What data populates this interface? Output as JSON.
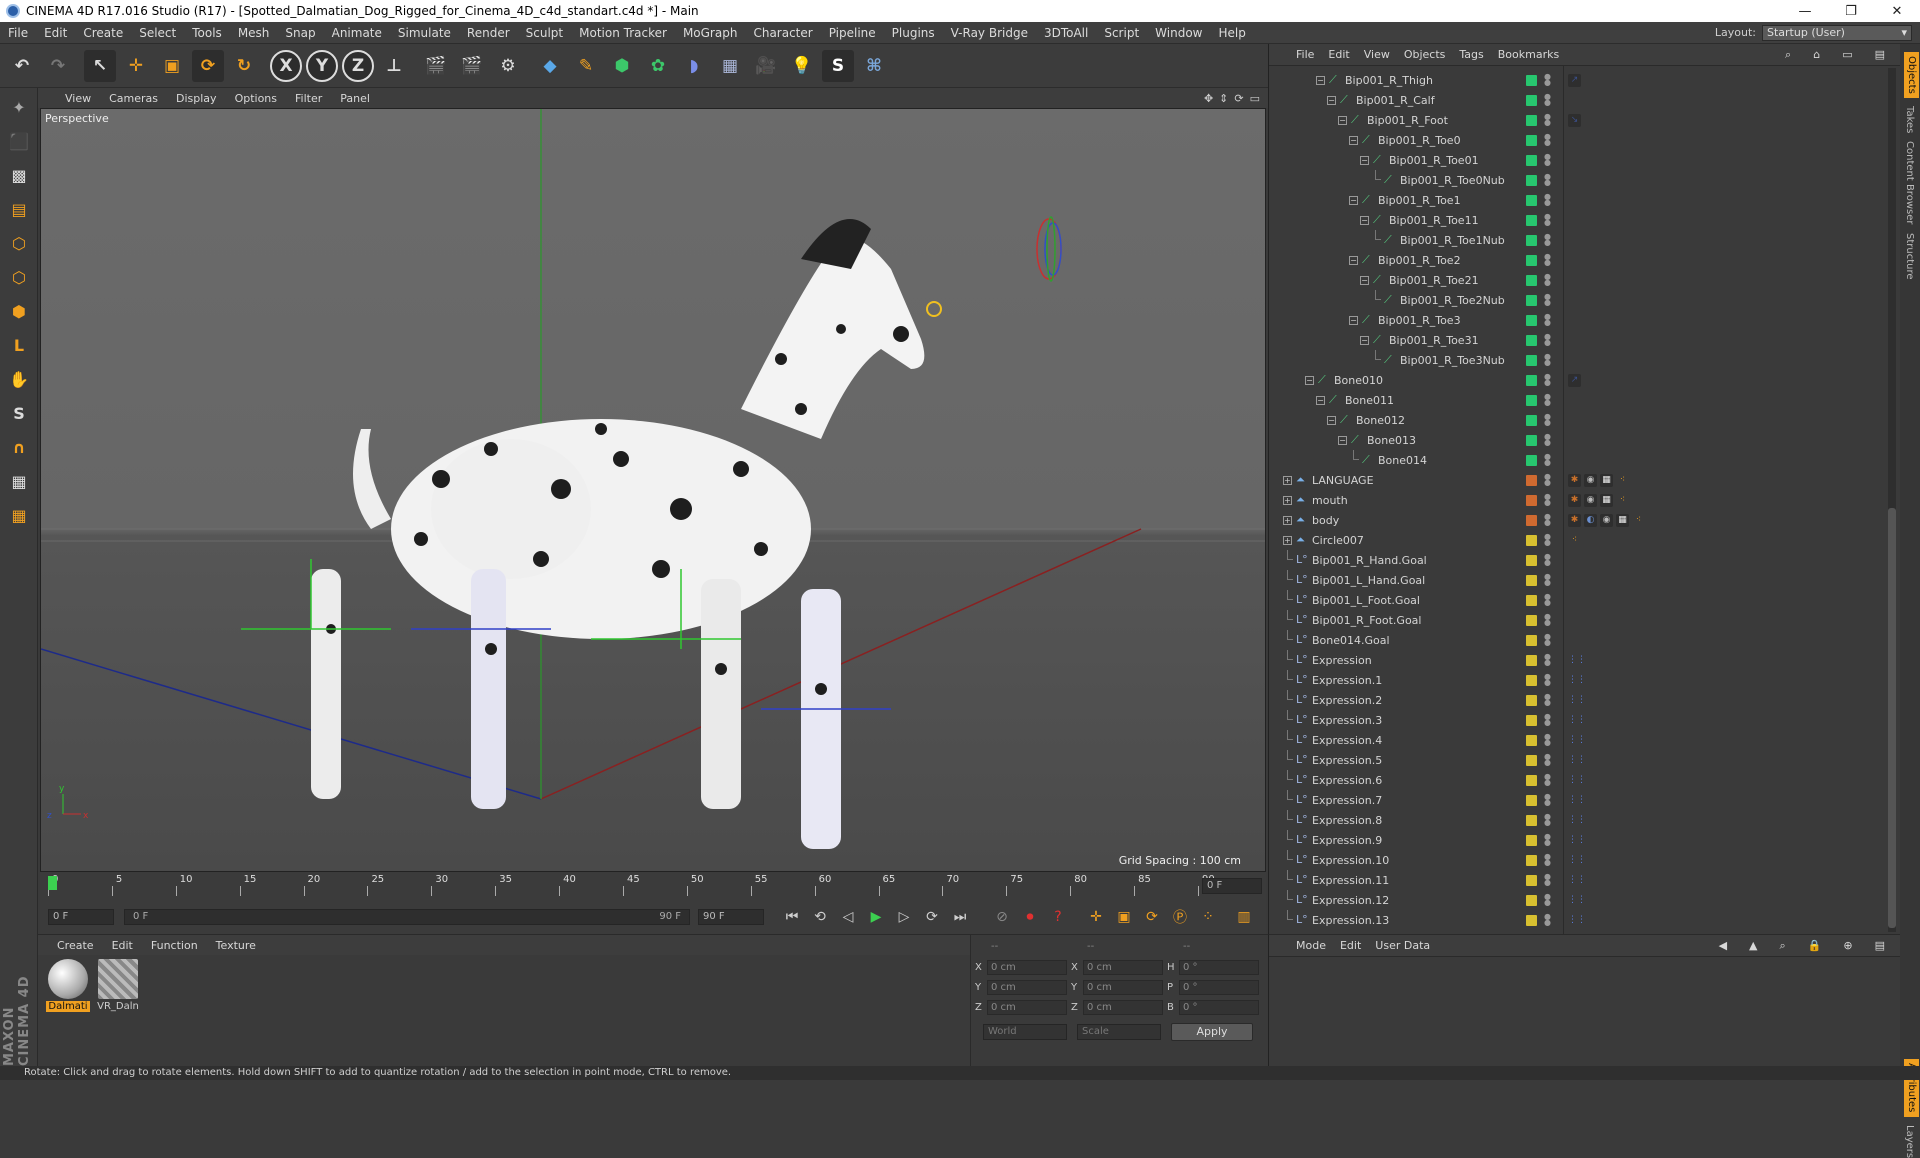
{
  "window": {
    "title": "CINEMA 4D R17.016 Studio (R17) - [Spotted_Dalmatian_Dog_Rigged_for_Cinema_4D_c4d_standart.c4d *] - Main",
    "min": "—",
    "max": "❐",
    "close": "✕"
  },
  "menu": [
    "File",
    "Edit",
    "Create",
    "Select",
    "Tools",
    "Mesh",
    "Snap",
    "Animate",
    "Simulate",
    "Render",
    "Sculpt",
    "Motion Tracker",
    "MoGraph",
    "Character",
    "Pipeline",
    "Plugins",
    "V-Ray Bridge",
    "3DToAll",
    "Script",
    "Window",
    "Help"
  ],
  "layout": {
    "label": "Layout:",
    "value": "Startup (User)"
  },
  "viewport": {
    "menu": [
      "View",
      "Cameras",
      "Display",
      "Options",
      "Filter",
      "Panel"
    ],
    "camera_label": "Perspective",
    "grid_spacing": "Grid Spacing : 100 cm"
  },
  "timeline": {
    "ticks": [
      "0",
      "5",
      "10",
      "15",
      "20",
      "25",
      "30",
      "35",
      "40",
      "45",
      "50",
      "55",
      "60",
      "65",
      "70",
      "75",
      "80",
      "85",
      "90"
    ],
    "current_frame_field": "0 F",
    "start_field": "0 F",
    "range_start": "0 F",
    "range_end": "90 F",
    "end_field": "90 F",
    "playhead_fraction": 0.0
  },
  "material_panel": {
    "menu": [
      "Create",
      "Edit",
      "Function",
      "Texture"
    ],
    "materials": [
      {
        "label": "Dalmati",
        "selected": true
      },
      {
        "label": "VR_Daln",
        "selected": false
      }
    ]
  },
  "coordinates": {
    "header": [
      "--",
      "--",
      "--"
    ],
    "rows": [
      {
        "a_label": "X",
        "a_val": "0 cm",
        "b_label": "X",
        "b_val": "0 cm",
        "c_label": "H",
        "c_val": "0 °"
      },
      {
        "a_label": "Y",
        "a_val": "0 cm",
        "b_label": "Y",
        "b_val": "0 cm",
        "c_label": "P",
        "c_val": "0 °"
      },
      {
        "a_label": "Z",
        "a_val": "0 cm",
        "b_label": "Z",
        "b_val": "0 cm",
        "c_label": "B",
        "c_val": "0 °"
      }
    ],
    "mode_select": "World",
    "scale_select": "Scale",
    "apply": "Apply"
  },
  "object_manager": {
    "menu": [
      "File",
      "Edit",
      "View",
      "Objects",
      "Tags",
      "Bookmarks"
    ],
    "rows": [
      {
        "name": "Bip001_R_Thigh",
        "depth": 3,
        "icon": "bone",
        "layer": "#27c76f",
        "expand": "minus",
        "tags": [
          "ik"
        ]
      },
      {
        "name": "Bip001_R_Calf",
        "depth": 4,
        "icon": "bone",
        "layer": "#27c76f",
        "expand": "minus",
        "tags": []
      },
      {
        "name": "Bip001_R_Foot",
        "depth": 5,
        "icon": "bone",
        "layer": "#27c76f",
        "expand": "minus",
        "tags": [
          "ik2"
        ]
      },
      {
        "name": "Bip001_R_Toe0",
        "depth": 6,
        "icon": "bone",
        "layer": "#27c76f",
        "expand": "minus",
        "tags": []
      },
      {
        "name": "Bip001_R_Toe01",
        "depth": 7,
        "icon": "bone",
        "layer": "#27c76f",
        "expand": "minus",
        "tags": []
      },
      {
        "name": "Bip001_R_Toe0Nub",
        "depth": 8,
        "icon": "bone",
        "layer": "#27c76f",
        "expand": "none",
        "tags": []
      },
      {
        "name": "Bip001_R_Toe1",
        "depth": 6,
        "icon": "bone",
        "layer": "#27c76f",
        "expand": "minus",
        "tags": []
      },
      {
        "name": "Bip001_R_Toe11",
        "depth": 7,
        "icon": "bone",
        "layer": "#27c76f",
        "expand": "minus",
        "tags": []
      },
      {
        "name": "Bip001_R_Toe1Nub",
        "depth": 8,
        "icon": "bone",
        "layer": "#27c76f",
        "expand": "none",
        "tags": []
      },
      {
        "name": "Bip001_R_Toe2",
        "depth": 6,
        "icon": "bone",
        "layer": "#27c76f",
        "expand": "minus",
        "tags": []
      },
      {
        "name": "Bip001_R_Toe21",
        "depth": 7,
        "icon": "bone",
        "layer": "#27c76f",
        "expand": "minus",
        "tags": []
      },
      {
        "name": "Bip001_R_Toe2Nub",
        "depth": 8,
        "icon": "bone",
        "layer": "#27c76f",
        "expand": "none",
        "tags": []
      },
      {
        "name": "Bip001_R_Toe3",
        "depth": 6,
        "icon": "bone",
        "layer": "#27c76f",
        "expand": "minus",
        "tags": []
      },
      {
        "name": "Bip001_R_Toe31",
        "depth": 7,
        "icon": "bone",
        "layer": "#27c76f",
        "expand": "minus",
        "tags": []
      },
      {
        "name": "Bip001_R_Toe3Nub",
        "depth": 8,
        "icon": "bone",
        "layer": "#27c76f",
        "expand": "none",
        "tags": []
      },
      {
        "name": "Bone010",
        "depth": 2,
        "icon": "bone",
        "layer": "#27c76f",
        "expand": "minus",
        "tags": [
          "ik"
        ]
      },
      {
        "name": "Bone011",
        "depth": 3,
        "icon": "bone",
        "layer": "#27c76f",
        "expand": "minus",
        "tags": []
      },
      {
        "name": "Bone012",
        "depth": 4,
        "icon": "bone",
        "layer": "#27c76f",
        "expand": "minus",
        "tags": []
      },
      {
        "name": "Bone013",
        "depth": 5,
        "icon": "bone",
        "layer": "#27c76f",
        "expand": "minus",
        "tags": []
      },
      {
        "name": "Bone014",
        "depth": 6,
        "icon": "bone",
        "layer": "#27c76f",
        "expand": "none",
        "tags": []
      },
      {
        "name": "LANGUAGE",
        "depth": 0,
        "icon": "mesh",
        "layer": "#d06a30",
        "expand": "plus",
        "tags": [
          "skin",
          "mat",
          "checker",
          "vertex"
        ]
      },
      {
        "name": "mouth",
        "depth": 0,
        "icon": "mesh",
        "layer": "#d06a30",
        "expand": "plus",
        "tags": [
          "skin",
          "mat",
          "checker",
          "vertex"
        ]
      },
      {
        "name": "body",
        "depth": 0,
        "icon": "mesh",
        "layer": "#d06a30",
        "expand": "plus",
        "tags": [
          "skin",
          "phong",
          "mat",
          "checker",
          "vertex"
        ]
      },
      {
        "name": "Circle007",
        "depth": 0,
        "icon": "mesh",
        "layer": "#d8c030",
        "expand": "plus",
        "tags": [
          "vertex"
        ]
      },
      {
        "name": "Bip001_R_Hand.Goal",
        "depth": 0,
        "icon": "null",
        "layer": "#d8c030",
        "expand": "none",
        "tags": []
      },
      {
        "name": "Bip001_L_Hand.Goal",
        "depth": 0,
        "icon": "null",
        "layer": "#d8c030",
        "expand": "none",
        "tags": []
      },
      {
        "name": "Bip001_L_Foot.Goal",
        "depth": 0,
        "icon": "null",
        "layer": "#d8c030",
        "expand": "none",
        "tags": []
      },
      {
        "name": "Bip001_R_Foot.Goal",
        "depth": 0,
        "icon": "null",
        "layer": "#d8c030",
        "expand": "none",
        "tags": []
      },
      {
        "name": "Bone014.Goal",
        "depth": 0,
        "icon": "null",
        "layer": "#d8c030",
        "expand": "none",
        "tags": []
      },
      {
        "name": "Expression",
        "depth": 0,
        "icon": "null",
        "layer": "#d8c030",
        "expand": "none",
        "tags": [
          "xpresso"
        ]
      },
      {
        "name": "Expression.1",
        "depth": 0,
        "icon": "null",
        "layer": "#d8c030",
        "expand": "none",
        "tags": [
          "xpresso"
        ]
      },
      {
        "name": "Expression.2",
        "depth": 0,
        "icon": "null",
        "layer": "#d8c030",
        "expand": "none",
        "tags": [
          "xpresso"
        ]
      },
      {
        "name": "Expression.3",
        "depth": 0,
        "icon": "null",
        "layer": "#d8c030",
        "expand": "none",
        "tags": [
          "xpresso"
        ]
      },
      {
        "name": "Expression.4",
        "depth": 0,
        "icon": "null",
        "layer": "#d8c030",
        "expand": "none",
        "tags": [
          "xpresso"
        ]
      },
      {
        "name": "Expression.5",
        "depth": 0,
        "icon": "null",
        "layer": "#d8c030",
        "expand": "none",
        "tags": [
          "xpresso"
        ]
      },
      {
        "name": "Expression.6",
        "depth": 0,
        "icon": "null",
        "layer": "#d8c030",
        "expand": "none",
        "tags": [
          "xpresso"
        ]
      },
      {
        "name": "Expression.7",
        "depth": 0,
        "icon": "null",
        "layer": "#d8c030",
        "expand": "none",
        "tags": [
          "xpresso"
        ]
      },
      {
        "name": "Expression.8",
        "depth": 0,
        "icon": "null",
        "layer": "#d8c030",
        "expand": "none",
        "tags": [
          "xpresso"
        ]
      },
      {
        "name": "Expression.9",
        "depth": 0,
        "icon": "null",
        "layer": "#d8c030",
        "expand": "none",
        "tags": [
          "xpresso"
        ]
      },
      {
        "name": "Expression.10",
        "depth": 0,
        "icon": "null",
        "layer": "#d8c030",
        "expand": "none",
        "tags": [
          "xpresso"
        ]
      },
      {
        "name": "Expression.11",
        "depth": 0,
        "icon": "null",
        "layer": "#d8c030",
        "expand": "none",
        "tags": [
          "xpresso"
        ]
      },
      {
        "name": "Expression.12",
        "depth": 0,
        "icon": "null",
        "layer": "#d8c030",
        "expand": "none",
        "tags": [
          "xpresso"
        ]
      },
      {
        "name": "Expression.13",
        "depth": 0,
        "icon": "null",
        "layer": "#d8c030",
        "expand": "none",
        "tags": [
          "xpresso"
        ]
      }
    ]
  },
  "attributes": {
    "menu": [
      "Mode",
      "Edit",
      "User Data"
    ]
  },
  "side_tabs": [
    "Objects",
    "Takes",
    "Content Browser",
    "Structure",
    "Attributes",
    "Layers"
  ],
  "brand": "MAXON CINEMA 4D",
  "status": "Rotate: Click and drag to rotate elements. Hold down SHIFT to add to quantize rotation / add to the selection in point mode, CTRL to remove.",
  "colors": {
    "accent_orange": "#f0a020",
    "bone_green": "#56c97f"
  }
}
